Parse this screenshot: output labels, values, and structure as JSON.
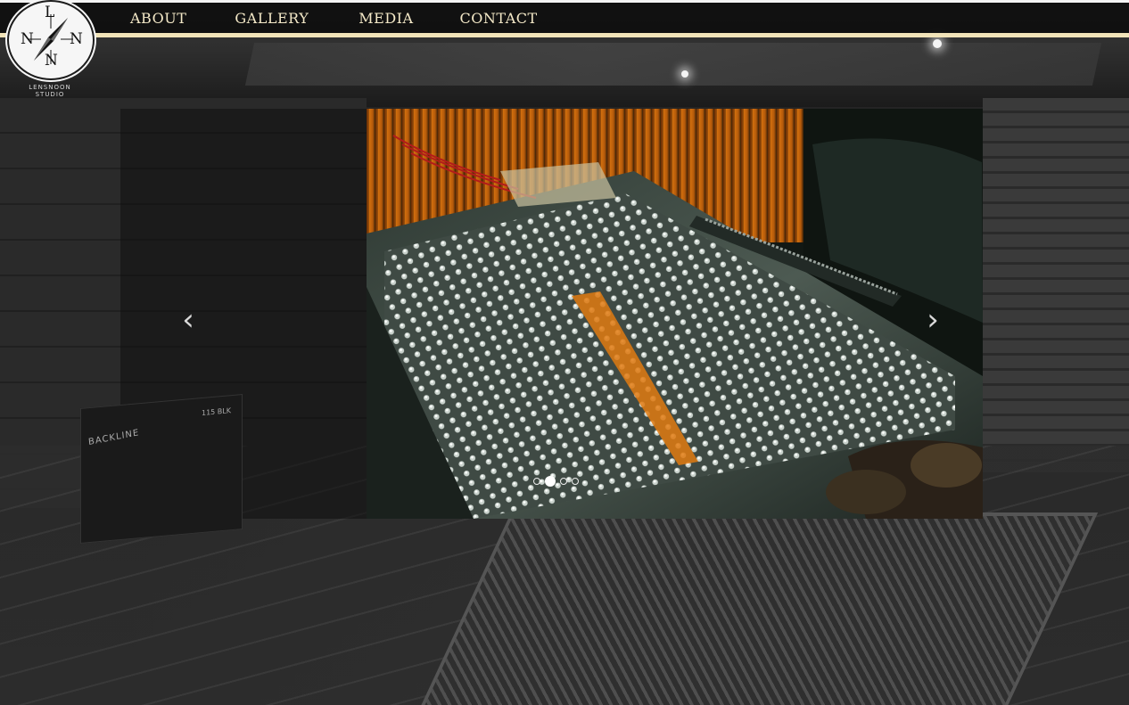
{
  "nav": {
    "items": [
      {
        "label": "ABOUT"
      },
      {
        "label": "GALLERY"
      },
      {
        "label": "MEDIA"
      },
      {
        "label": "CONTACT"
      }
    ]
  },
  "logo": {
    "letters": {
      "top": "L",
      "left": "N",
      "right": "N",
      "bottom": "N"
    },
    "subtitle_line1": "LENSNOON",
    "subtitle_line2": "STUDIO"
  },
  "background": {
    "amp_label": "BACKLINE",
    "amp_model": "115 BLK"
  },
  "carousel": {
    "slide_count": 4,
    "active_index": 1,
    "prev_icon": "chevron-left-icon",
    "next_icon": "chevron-right-icon",
    "prev_glyph": "‹",
    "next_glyph": "›"
  },
  "colors": {
    "nav_text": "#f4e9c8",
    "nav_underline": "#f1e3b8",
    "console_orange": "#e07a10"
  }
}
